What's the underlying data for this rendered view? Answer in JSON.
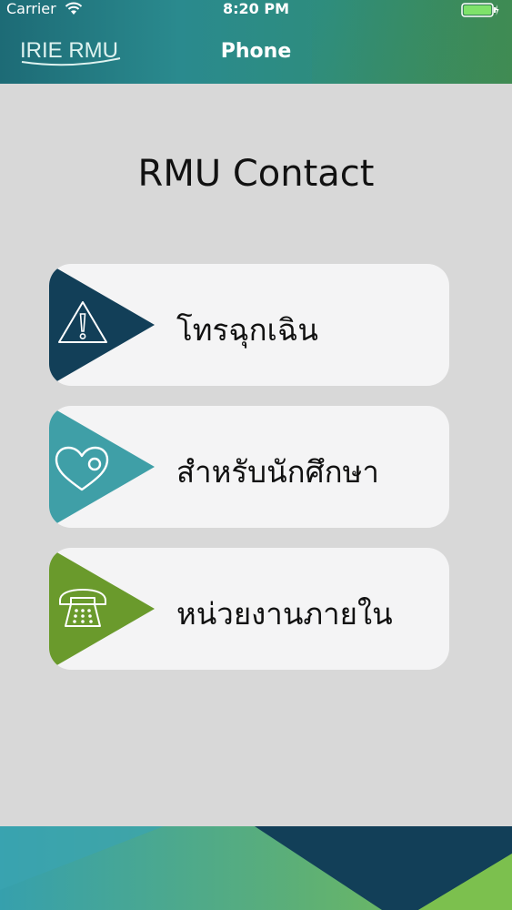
{
  "status_bar": {
    "carrier": "Carrier",
    "time": "8:20 PM"
  },
  "nav": {
    "logo_text": "IRIE RMU",
    "title": "Phone"
  },
  "page": {
    "heading": "RMU Contact"
  },
  "menu": {
    "items": [
      {
        "label": "โทรฉุกเฉิน",
        "icon": "warning-icon",
        "color": "#123f58"
      },
      {
        "label": "สำหรับนักศึกษา",
        "icon": "heart-icon",
        "color": "#3f9fa7"
      },
      {
        "label": "หน่วยงานภายใน",
        "icon": "telephone-icon",
        "color": "#6a9a2c"
      }
    ]
  },
  "colors": {
    "background": "#d8d8d8",
    "card": "#f4f4f5",
    "header_teal": "#2a8a8e",
    "footer_navy": "#123f58",
    "footer_green": "#6fb150"
  }
}
